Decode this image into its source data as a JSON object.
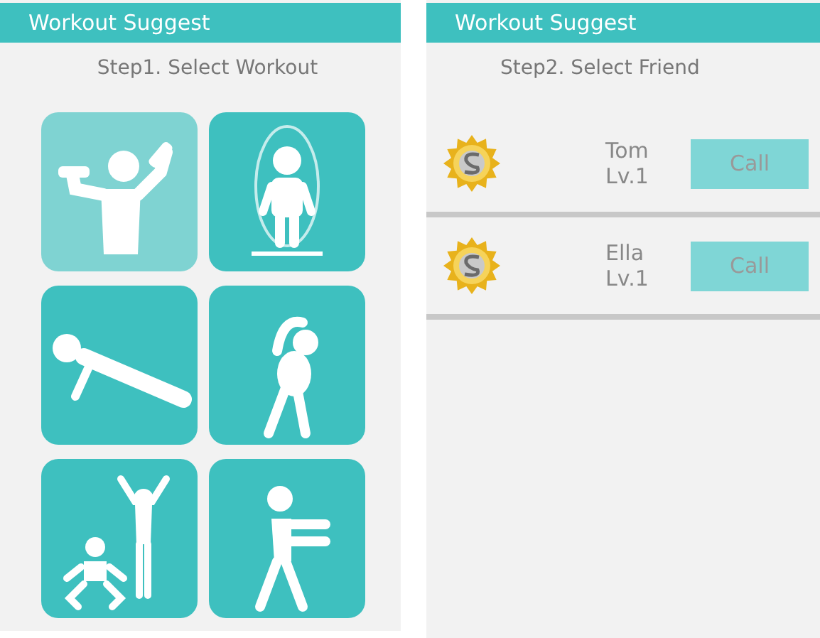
{
  "screens": [
    {
      "title": "Workout Suggest",
      "step": "Step1. Select Workout",
      "workouts": [
        {
          "kind": "dumbbell",
          "selected": true
        },
        {
          "kind": "jumprope",
          "selected": false
        },
        {
          "kind": "pushup",
          "selected": false
        },
        {
          "kind": "stretch",
          "selected": false
        },
        {
          "kind": "squat",
          "selected": false
        },
        {
          "kind": "walk",
          "selected": false
        }
      ]
    },
    {
      "title": "Workout Suggest",
      "step": "Step2. Select Friend",
      "friends": [
        {
          "name": "Tom",
          "level": "Lv.1",
          "button": "Call"
        },
        {
          "name": "Ella",
          "level": "Lv.1",
          "button": "Call"
        }
      ]
    }
  ]
}
